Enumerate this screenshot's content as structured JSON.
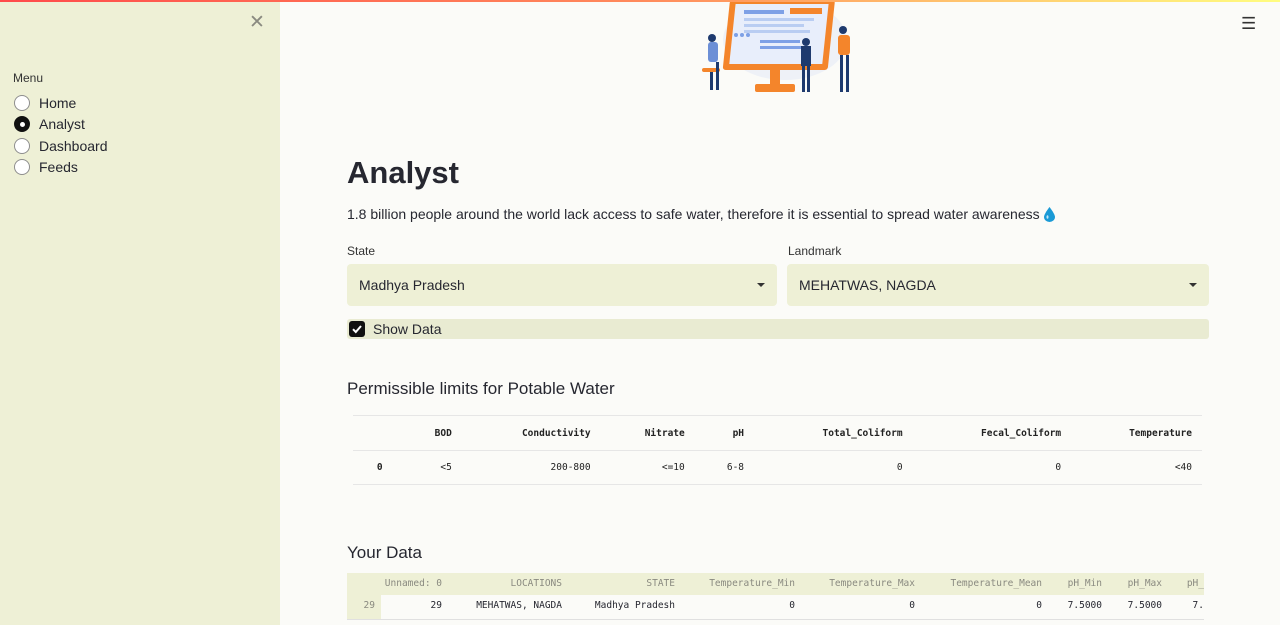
{
  "sidebar": {
    "menu_label": "Menu",
    "close_icon": "close-icon",
    "items": [
      {
        "label": "Home",
        "selected": false
      },
      {
        "label": "Analyst",
        "selected": true
      },
      {
        "label": "Dashboard",
        "selected": false
      },
      {
        "label": "Feeds",
        "selected": false
      }
    ]
  },
  "header": {
    "menu_icon": "hamburger-menu-icon"
  },
  "page": {
    "title": "Analyst",
    "subtitle": "1.8 billion people around the world lack access to safe water, therefore it is essential to spread water awareness",
    "subtitle_icon": "water-drop-icon"
  },
  "filters": {
    "state_label": "State",
    "state_value": "Madhya Pradesh",
    "landmark_label": "Landmark",
    "landmark_value": "MEHATWAS, NAGDA",
    "show_data_label": "Show Data",
    "show_data_checked": true
  },
  "limits": {
    "heading": "Permissible limits for Potable Water",
    "columns": [
      "",
      "BOD",
      "Conductivity",
      "Nitrate",
      "pH",
      "Total_Coliform",
      "Fecal_Coliform",
      "Temperature"
    ],
    "rows": [
      [
        "0",
        "<5",
        "200-800",
        "<=10",
        "6-8",
        "0",
        "0",
        "<40"
      ]
    ]
  },
  "your_data": {
    "heading": "Your Data",
    "columns": [
      "Unnamed: 0",
      "LOCATIONS",
      "STATE",
      "Temperature_Min",
      "Temperature_Max",
      "Temperature_Mean",
      "pH_Min",
      "pH_Max",
      "pH_"
    ],
    "row_index": "29",
    "row": [
      "29",
      "MEHATWAS, NAGDA",
      "Madhya Pradesh",
      "0",
      "0",
      "0",
      "7.5000",
      "7.5000",
      "7."
    ]
  },
  "colors": {
    "sidebar_bg": "#eef0d6",
    "page_bg": "#fbfbf8",
    "accent": "#111111",
    "illustration_orange": "#f4852b",
    "illustration_blue": "#1e3a6e"
  }
}
